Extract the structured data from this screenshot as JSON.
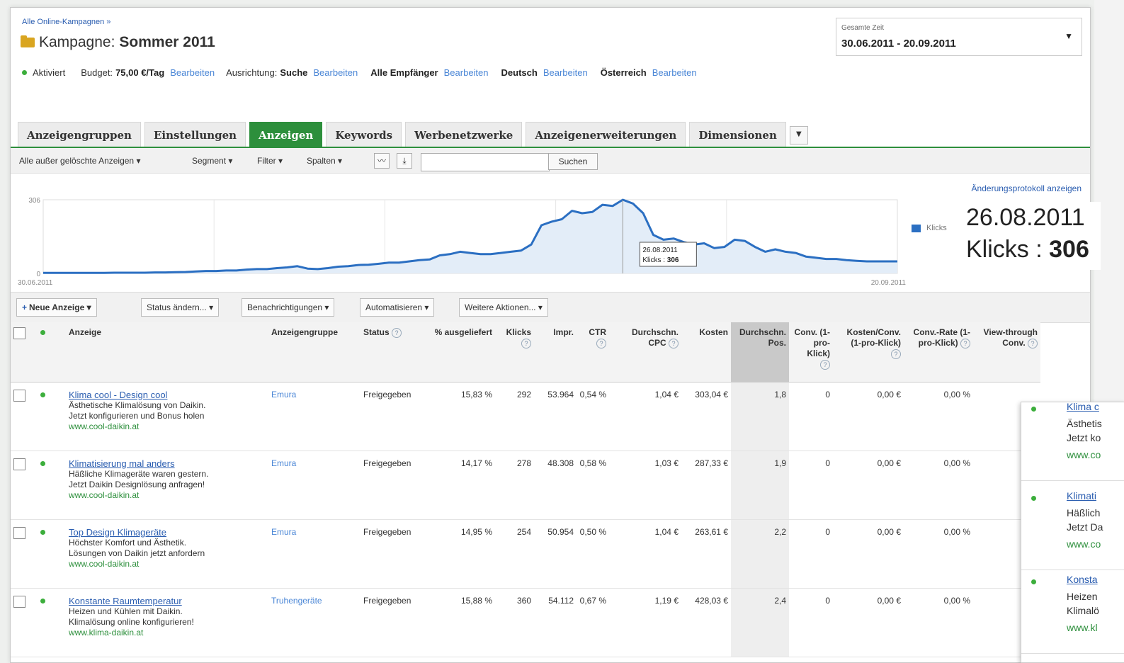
{
  "header": {
    "breadcrumb": "Alle Online-Kampagnen »",
    "campaign_prefix": "Kampagne:",
    "campaign_name": "Sommer 2011",
    "status": "Aktiviert",
    "budget_label": "Budget:",
    "budget_value": "75,00 €/Tag",
    "targeting_label": "Ausrichtung:",
    "targeting_value": "Suche",
    "recipients": "Alle Empfänger",
    "language": "Deutsch",
    "country": "Österreich",
    "edit_label": "Bearbeiten"
  },
  "daterange": {
    "label": "Gesamte Zeit",
    "value": "30.06.2011 - 20.09.2011"
  },
  "tabs": [
    "Anzeigengruppen",
    "Einstellungen",
    "Anzeigen",
    "Keywords",
    "Werbenetzwerke",
    "Anzeigenerweiterungen",
    "Dimensionen"
  ],
  "active_tab": "Anzeigen",
  "toolbar": {
    "filter_all": "Alle außer gelöschte Anzeigen",
    "segment": "Segment",
    "filter": "Filter",
    "columns": "Spalten",
    "search_button": "Suchen",
    "search_value": ""
  },
  "change_log_link": "Änderungsprotokoll anzeigen",
  "chart_data": {
    "type": "area",
    "series": [
      {
        "name": "Klicks",
        "values": [
          2,
          2,
          2,
          2,
          2,
          2,
          2,
          3,
          3,
          3,
          3,
          4,
          4,
          5,
          6,
          8,
          10,
          10,
          12,
          12,
          16,
          18,
          18,
          22,
          25,
          30,
          20,
          18,
          22,
          28,
          30,
          35,
          36,
          40,
          45,
          45,
          50,
          55,
          58,
          75,
          80,
          90,
          85,
          80,
          80,
          85,
          90,
          95,
          120,
          200,
          215,
          225,
          260,
          250,
          255,
          285,
          280,
          306,
          290,
          250,
          160,
          140,
          145,
          130,
          120,
          125,
          105,
          110,
          140,
          135,
          110,
          90,
          100,
          90,
          85,
          70,
          65,
          60,
          60,
          55,
          52,
          50,
          50,
          50,
          50
        ]
      }
    ],
    "x_start": "30.06.2011",
    "x_end": "20.09.2011",
    "ylim": [
      0,
      306
    ],
    "y_ticks": [
      0,
      306
    ],
    "tooltip_date": "26.08.2011",
    "tooltip_text": "Klicks : 306",
    "tooltip_label": "Klicks : ",
    "tooltip_value": "306",
    "grid": true,
    "legend_position": "right",
    "color": "#2b6fc2"
  },
  "zoom_tooltip": {
    "date": "26.08.2011",
    "label": "Klicks : ",
    "value": "306"
  },
  "actions": {
    "new_ad": "Neue Anzeige",
    "change_status": "Status ändern...",
    "notifications": "Benachrichtigungen",
    "automate": "Automatisieren",
    "more": "Weitere Aktionen..."
  },
  "table": {
    "headers": {
      "ad": "Anzeige",
      "adgroup": "Anzeigengruppe",
      "status": "Status",
      "served": "% ausgeliefert",
      "clicks": "Klicks",
      "impr": "Impr.",
      "ctr": "CTR",
      "cpc": "Durchschn. CPC",
      "cost": "Kosten",
      "pos": "Durchschn. Pos.",
      "conv": "Conv. (1-pro-Klick)",
      "cost_conv": "Kosten/Conv. (1-pro-Klick)",
      "conv_rate": "Conv.-Rate (1-pro-Klick)",
      "view_through": "View-through Conv."
    },
    "rows": [
      {
        "title": "Klima cool - Design cool",
        "line1": "Ästhetische Klimalösung von Daikin.",
        "line2": "Jetzt konfigurieren und Bonus holen",
        "url": "www.cool-daikin.at",
        "group": "Emura",
        "status": "Freigegeben",
        "served": "15,83 %",
        "clicks": "292",
        "impr": "53.964",
        "ctr": "0,54 %",
        "cpc": "1,04 €",
        "cost": "303,04 €",
        "pos": "1,8",
        "conv": "0",
        "cost_conv": "0,00 €",
        "conv_rate": "0,00 %"
      },
      {
        "title": "Klimatisierung mal anders",
        "line1": "Häßliche Klimageräte waren gestern.",
        "line2": "Jetzt Daikin Designlösung anfragen!",
        "url": "www.cool-daikin.at",
        "group": "Emura",
        "status": "Freigegeben",
        "served": "14,17 %",
        "clicks": "278",
        "impr": "48.308",
        "ctr": "0,58 %",
        "cpc": "1,03 €",
        "cost": "287,33 €",
        "pos": "1,9",
        "conv": "0",
        "cost_conv": "0,00 €",
        "conv_rate": "0,00 %"
      },
      {
        "title": "Top Design Klimageräte",
        "line1": "Höchster Komfort und Ästhetik.",
        "line2": "Lösungen von Daikin jetzt anfordern",
        "url": "www.cool-daikin.at",
        "group": "Emura",
        "status": "Freigegeben",
        "served": "14,95 %",
        "clicks": "254",
        "impr": "50.954",
        "ctr": "0,50 %",
        "cpc": "1,04 €",
        "cost": "263,61 €",
        "pos": "2,2",
        "conv": "0",
        "cost_conv": "0,00 €",
        "conv_rate": "0,00 %"
      },
      {
        "title": "Konstante Raumtemperatur",
        "line1": "Heizen und Kühlen mit Daikin.",
        "line2": "Klimalösung online konfigurieren!",
        "url": "www.klima-daikin.at",
        "group": "Truhengeräte",
        "status": "Freigegeben",
        "served": "15,88 %",
        "clicks": "360",
        "impr": "54.112",
        "ctr": "0,67 %",
        "cpc": "1,19 €",
        "cost": "428,03 €",
        "pos": "2,4",
        "conv": "0",
        "cost_conv": "0,00 €",
        "conv_rate": "0,00 %"
      }
    ]
  },
  "popup_rows": [
    {
      "title": "Klima c",
      "line1": "Ästhetis",
      "line2": "Jetzt ko",
      "url": "www.co"
    },
    {
      "title": "Klimati",
      "line1": "Häßlich",
      "line2": "Jetzt Da",
      "url": "www.co"
    },
    {
      "title": "Konsta",
      "line1": "Heizen",
      "line2": "Klimalö",
      "url": "www.kl"
    }
  ]
}
